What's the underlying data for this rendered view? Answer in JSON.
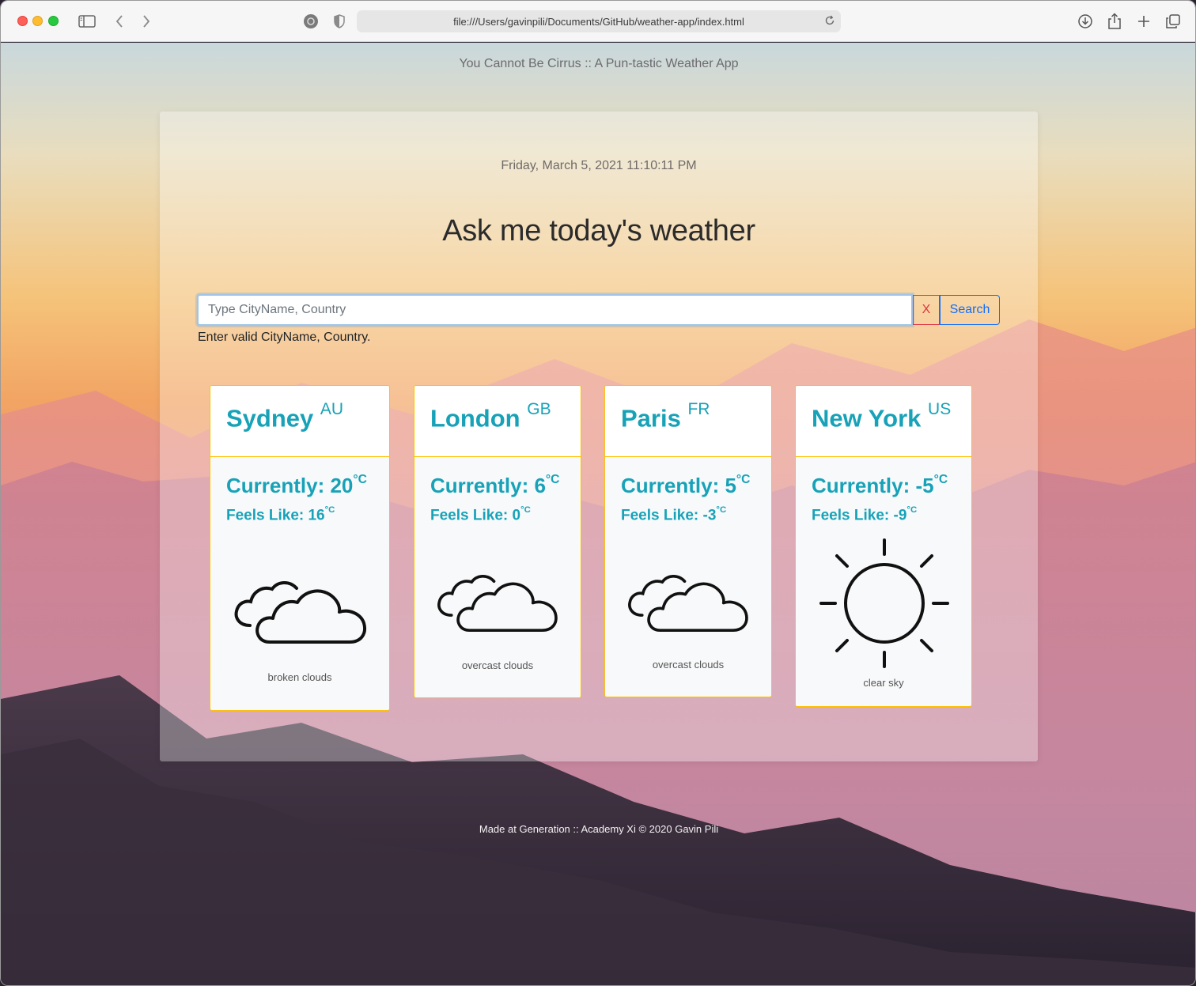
{
  "browser": {
    "url": "file:///Users/gavinpili/Documents/GitHub/weather-app/index.html"
  },
  "page": {
    "site_title": "You Cannot Be Cirrus :: A Pun-tastic Weather App",
    "date": "Friday, March 5, 2021 11:10:11 PM",
    "heading": "Ask me today's weather",
    "search": {
      "placeholder": "Type CityName, Country",
      "clear_label": "X",
      "submit_label": "Search",
      "hint": "Enter valid CityName, Country."
    },
    "cards": [
      {
        "city": "Sydney",
        "country": "AU",
        "current_label": "Currently: 20",
        "feels_label": "Feels Like: 16",
        "unit": "°C",
        "icon": "broken-clouds-icon",
        "description": "broken clouds"
      },
      {
        "city": "London",
        "country": "GB",
        "current_label": "Currently: 6",
        "feels_label": "Feels Like: 0",
        "unit": "°C",
        "icon": "overcast-clouds-icon",
        "description": "overcast clouds"
      },
      {
        "city": "Paris",
        "country": "FR",
        "current_label": "Currently: 5",
        "feels_label": "Feels Like: -3",
        "unit": "°C",
        "icon": "overcast-clouds-icon",
        "description": "overcast clouds"
      },
      {
        "city": "New York",
        "country": "US",
        "current_label": "Currently: -5",
        "feels_label": "Feels Like: -9",
        "unit": "°C",
        "icon": "sun-icon",
        "description": "clear sky"
      }
    ],
    "footer": "Made at Generation :: Academy Xi © 2020 Gavin Pili"
  },
  "colors": {
    "accent_teal": "#17a2b8",
    "card_border": "#ffc107",
    "search_blue": "#0d6efd",
    "clear_red": "#dc3545"
  }
}
